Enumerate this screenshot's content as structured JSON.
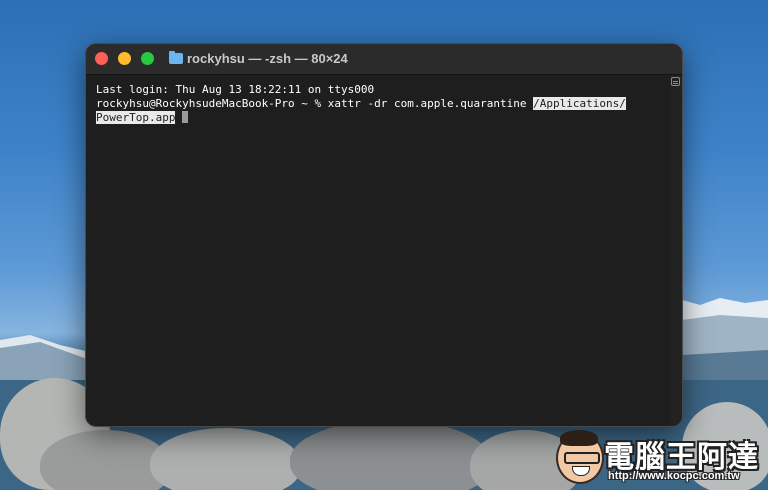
{
  "window": {
    "title": "rockyhsu — -zsh — 80×24",
    "icon": "folder-icon"
  },
  "terminal": {
    "line1": "Last login: Thu Aug 13 18:22:11 on ttys000",
    "prompt": "rockyhsu@RockyhsudeMacBook-Pro ~ % ",
    "command": "xattr -dr com.apple.quarantine ",
    "selected_path_part1": "/Applications/",
    "selected_path_part2": "PowerTop.app"
  },
  "watermark": {
    "title": "電腦王阿達",
    "url": "http://www.kocpc.com.tw"
  },
  "colors": {
    "close": "#fe5f57",
    "minimize": "#febc2e",
    "zoom": "#28c840",
    "terminal_bg": "#1e1e1e",
    "selection": "#e9e9e9"
  }
}
